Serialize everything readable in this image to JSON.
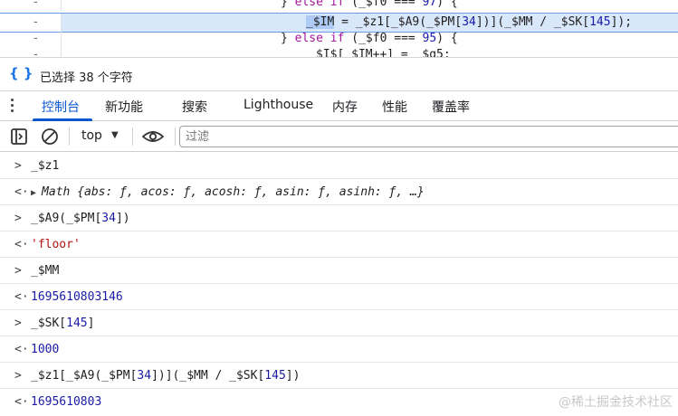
{
  "code": {
    "lines": [
      {
        "minus": "-",
        "pre": "} ",
        "kw1": "else if",
        "mid": " (_$f0 === ",
        "num": "97",
        "post": ") {"
      },
      {
        "minus": "-",
        "assign_left": "_$IM",
        "assign_rest": " = _$z1[_$A9(_$PM[",
        "n1": "34",
        "r1": "])](_$MM / _$SK[",
        "n2": "145",
        "r2": "]);"
      },
      {
        "minus": "-",
        "pre": "} ",
        "kw1": "else if",
        "mid": " (_$f0 === ",
        "num": "95",
        "post": ") {"
      },
      {
        "minus": "-",
        "text": "$I$[ $IM++] =  $g5;"
      }
    ]
  },
  "selection_bar": {
    "icon": "curly-braces-icon",
    "text": "已选择 38 个字符"
  },
  "tabs": [
    {
      "label": "控制台",
      "active": true
    },
    {
      "label": "新功能"
    },
    {
      "label": "搜索"
    },
    {
      "label": "Lighthouse"
    },
    {
      "label": "内存"
    },
    {
      "label": "性能"
    },
    {
      "label": "覆盖率"
    }
  ],
  "toolbar": {
    "context": "top",
    "filter_placeholder": "过滤"
  },
  "console": {
    "rows": [
      {
        "kind": "input",
        "arrow": ">",
        "text": "_$z1"
      },
      {
        "kind": "output",
        "arrow": "<·",
        "prefix": "Math ",
        "text": "{abs: ƒ, acos: ƒ, acosh: ƒ, asin: ƒ, asinh: ƒ, …}"
      },
      {
        "kind": "input",
        "arrow": ">",
        "text": "_$A9(_$PM[",
        "num": "34",
        "tail": "])"
      },
      {
        "kind": "output",
        "arrow": "<·",
        "str": "'floor'"
      },
      {
        "kind": "input",
        "arrow": ">",
        "text": "_$MM"
      },
      {
        "kind": "output",
        "arrow": "<·",
        "number": "1695610803146"
      },
      {
        "kind": "input",
        "arrow": ">",
        "text": "_$SK[",
        "num": "145",
        "tail": "]"
      },
      {
        "kind": "output",
        "arrow": "<·",
        "number": "1000"
      },
      {
        "kind": "input",
        "arrow": ">",
        "text": "_$z1[_$A9(_$PM[",
        "num": "34",
        "tail": "])](_$MM / _$SK[",
        "num2": "145",
        "tail2": "])"
      },
      {
        "kind": "output",
        "arrow": "<·",
        "number": "1695610803"
      }
    ]
  },
  "watermark": {
    "corner_text": "@稀土掘金技术社区"
  },
  "colors": {
    "accent": "#0b57d0",
    "string": "#b31412",
    "number": "#1a1aa6",
    "keyword": "#a1149c"
  }
}
